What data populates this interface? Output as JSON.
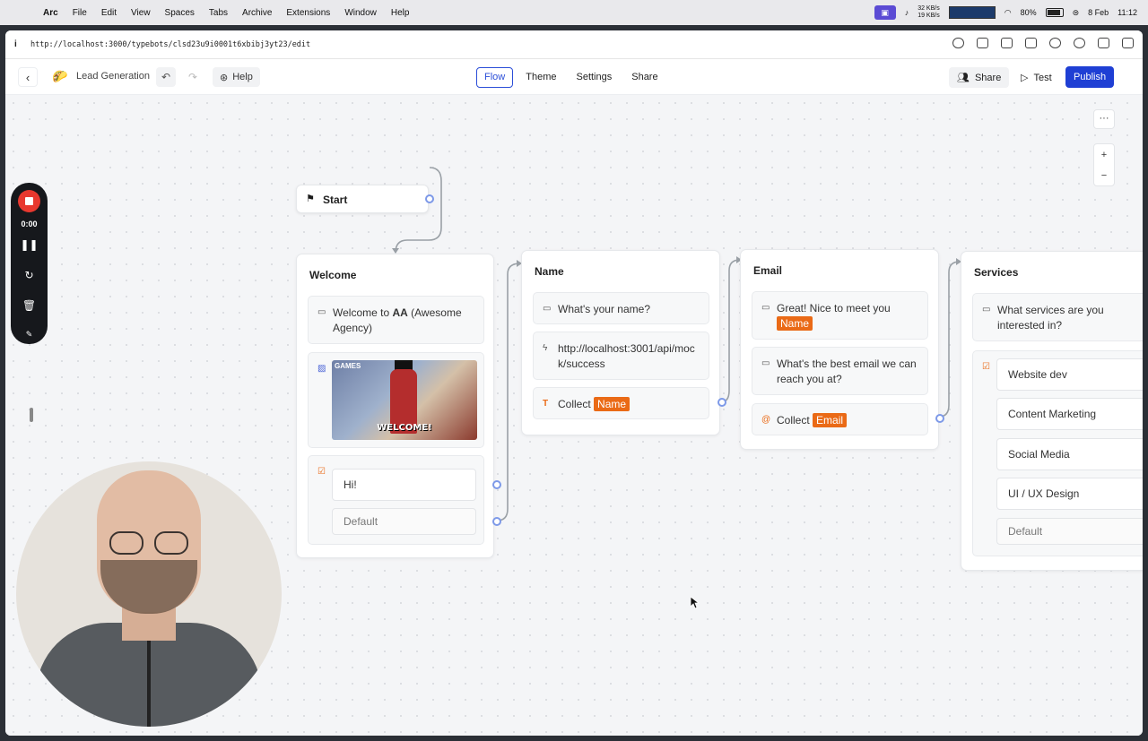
{
  "menubar": {
    "app": "Arc",
    "items": [
      "File",
      "Edit",
      "View",
      "Spaces",
      "Tabs",
      "Archive",
      "Extensions",
      "Window",
      "Help"
    ],
    "net_up": "32 KB/s",
    "net_down": "19 KB/s",
    "battery": "80%",
    "date": "8 Feb",
    "time": "11:12"
  },
  "browser": {
    "url": "http://localhost:3000/typebots/clsd23u9i0001t6xbibj3yt23/edit"
  },
  "header": {
    "bot_name": "Lead Generation",
    "help_label": "Help",
    "tabs": [
      "Flow",
      "Theme",
      "Settings",
      "Share"
    ],
    "active_tab": "Flow",
    "share_label": "Share",
    "test_label": "Test",
    "publish_label": "Publish"
  },
  "canvas": {
    "more_label": "···",
    "zoom_in": "+",
    "zoom_out": "−",
    "start": {
      "label": "Start"
    },
    "groups": {
      "welcome": {
        "title": "Welcome",
        "text_prefix": "Welcome to ",
        "text_bold": "AA",
        "text_suffix": " (Awesome Agency)",
        "gif_caption": "WELCOME!",
        "gif_corner": "GAMES",
        "buttons": [
          "Hi!",
          "Default"
        ]
      },
      "name": {
        "title": "Name",
        "question": "What's your name?",
        "webhook_url": "http://localhost:3001/api/mock/success",
        "collect_label": "Collect",
        "collect_var": "Name"
      },
      "email": {
        "title": "Email",
        "greeting": "Great! Nice to meet you",
        "greeting_var": "Name",
        "question": "What's the best email we can reach you at?",
        "collect_label": "Collect",
        "collect_var": "Email"
      },
      "services": {
        "title": "Services",
        "question": "What services are you interested in?",
        "options": [
          "Website dev",
          "Content Marketing",
          "Social Media",
          "UI / UX Design",
          "Default"
        ]
      }
    }
  },
  "recorder": {
    "time": "0:00"
  },
  "colors": {
    "accent": "#1f3fd4",
    "variable_chip": "#ea6a16",
    "port": "#7d99e8",
    "record": "#e8382f"
  }
}
